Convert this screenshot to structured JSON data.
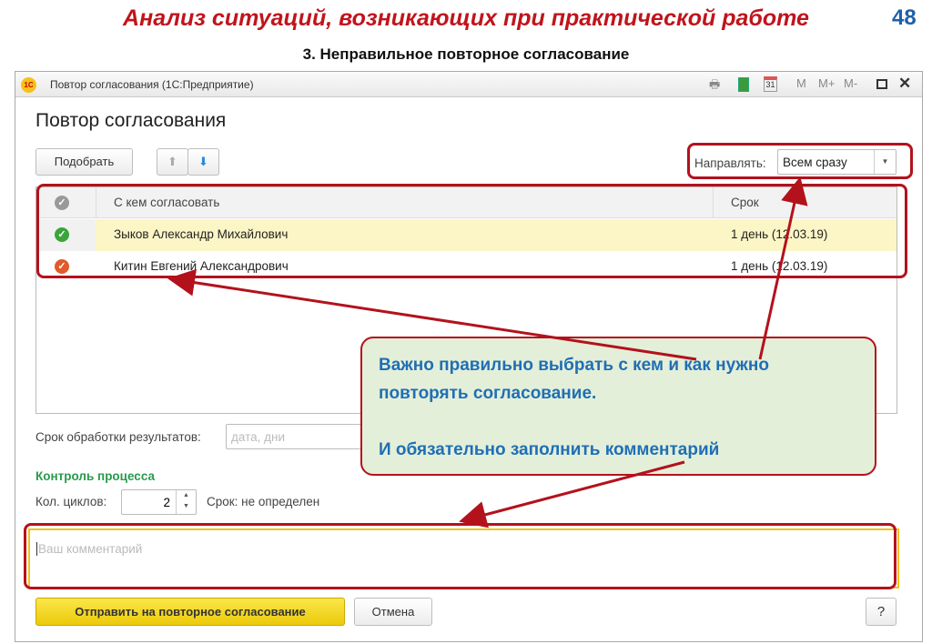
{
  "slide": {
    "title": "Анализ ситуаций, возникающих при практической работе",
    "page_number": "48",
    "subtitle": "3. Неправильное повторное согласование"
  },
  "window": {
    "title": "Повтор согласования  (1С:Предприятие)",
    "logo": "1С",
    "toolbar_icons": [
      "print-icon",
      "calculator-icon",
      "calendar-icon"
    ],
    "mem_buttons": [
      "M",
      "M+",
      "M-"
    ],
    "calendar_day": "31"
  },
  "form": {
    "title": "Повтор согласования",
    "pick_button": "Подобрать",
    "direct_label": "Направлять:",
    "direct_value": "Всем сразу",
    "table": {
      "columns": [
        "С кем согласовать",
        "Срок"
      ],
      "rows": [
        {
          "name": "Зыков Александр Михайлович",
          "term": "1 день (12.03.19)",
          "status": "approved",
          "status_color": "#3aa53a"
        },
        {
          "name": "Китин Евгений Александрович",
          "term": "1 день (12.03.19)",
          "status": "rejected",
          "status_color": "#e05a2b"
        }
      ]
    },
    "deadline_label": "Срок обработки результатов:",
    "deadline_placeholder": "дата, дни",
    "control_heading": "Контроль процесса",
    "cycles_label": "Кол. циклов:",
    "cycles_value": "2",
    "term_text": "Срок: не определен",
    "comment_placeholder": "Ваш комментарий",
    "submit_button": "Отправить на повторное согласование",
    "cancel_button": "Отмена",
    "help_button": "?"
  },
  "callout": {
    "line1": "Важно правильно выбрать с кем и как нужно повторять согласование.",
    "line2": "И обязательно заполнить комментарий"
  },
  "colors": {
    "accent_red": "#b3121c",
    "title_red": "#c0141c",
    "callout_bg": "#e4efd9",
    "callout_text": "#1f6fb5",
    "submit_yellow": "#f5d70c",
    "heading_green": "#2a9a4a"
  }
}
